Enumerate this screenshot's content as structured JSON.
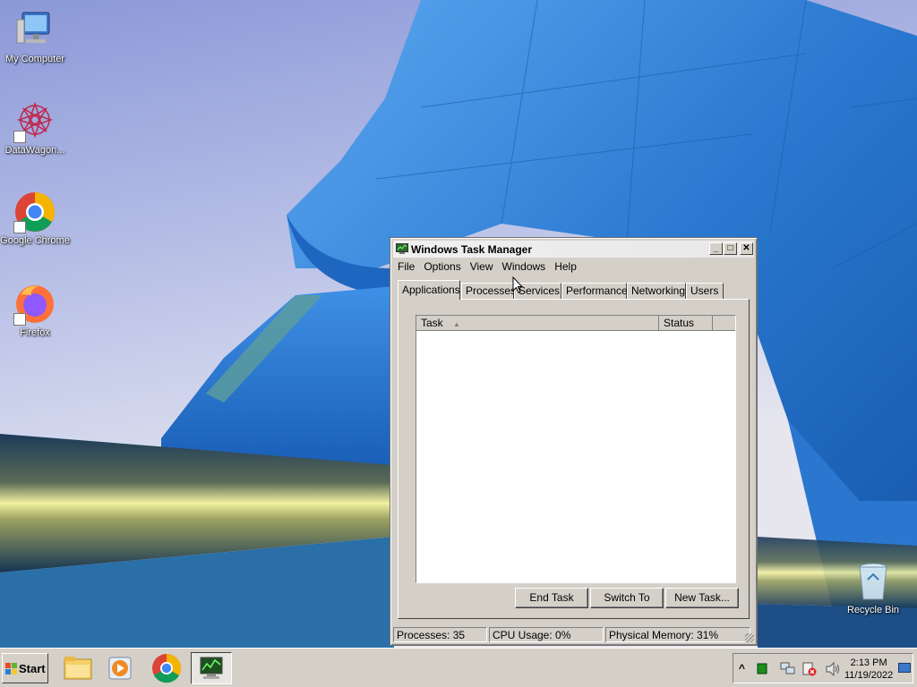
{
  "desktop": {
    "icons": [
      {
        "label": "My Computer"
      },
      {
        "label": "DataWagon..."
      },
      {
        "label": "Google Chrome"
      },
      {
        "label": "Firefox"
      },
      {
        "label": "Recycle Bin"
      }
    ]
  },
  "task_manager": {
    "title": "Windows Task Manager",
    "title_buttons": {
      "minimize": "_",
      "maximize": "□",
      "close": "✕"
    },
    "menu": [
      "File",
      "Options",
      "View",
      "Windows",
      "Help"
    ],
    "tabs": [
      "Applications",
      "Processes",
      "Services",
      "Performance",
      "Networking",
      "Users"
    ],
    "active_tab": "Applications",
    "columns": [
      "Task",
      "Status"
    ],
    "sort_indicator": "▲",
    "rows": [],
    "buttons": {
      "end_task": "End Task",
      "switch_to": "Switch To",
      "new_task": "New Task..."
    },
    "status": {
      "processes": "Processes: 35",
      "cpu": "CPU Usage: 0%",
      "memory": "Physical Memory: 31%"
    }
  },
  "taskbar": {
    "start_label": "Start",
    "clock_time": "2:13 PM",
    "clock_date": "11/19/2022",
    "tray_arrow": "^"
  },
  "colors": {
    "window_face": "#d4d0c8",
    "wallpaper_blue": "#2f7fd6"
  }
}
